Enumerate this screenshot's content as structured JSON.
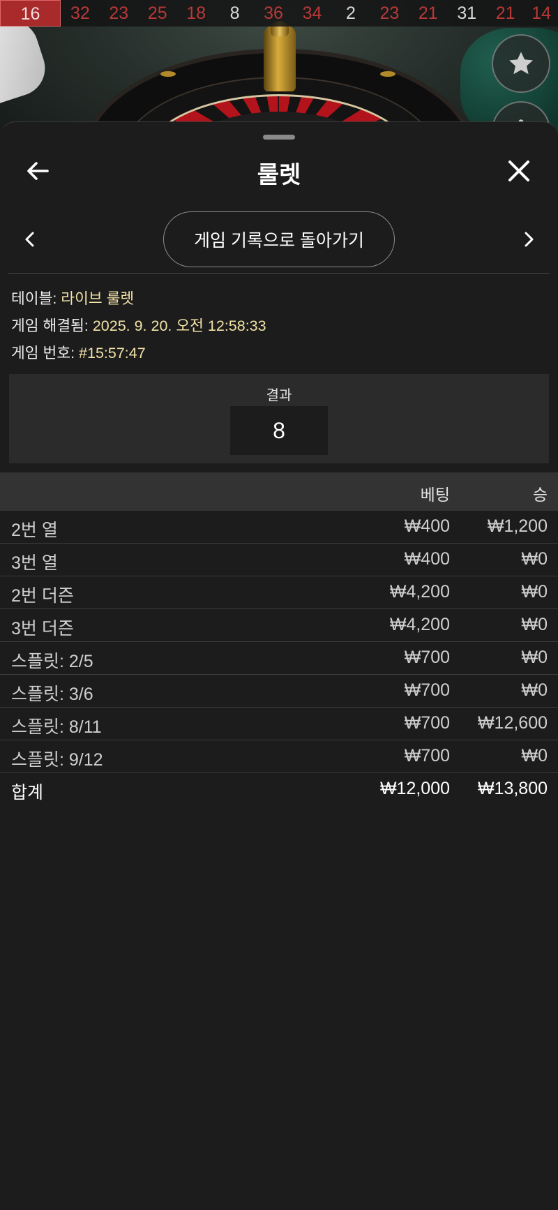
{
  "history": {
    "latest": "16",
    "items": [
      {
        "num": "32",
        "color": "red"
      },
      {
        "num": "23",
        "color": "red"
      },
      {
        "num": "25",
        "color": "red"
      },
      {
        "num": "18",
        "color": "red"
      },
      {
        "num": "8",
        "color": "black"
      },
      {
        "num": "36",
        "color": "red"
      },
      {
        "num": "34",
        "color": "red"
      },
      {
        "num": "2",
        "color": "black"
      },
      {
        "num": "23",
        "color": "red"
      },
      {
        "num": "21",
        "color": "red"
      },
      {
        "num": "31",
        "color": "black"
      },
      {
        "num": "21",
        "color": "red"
      },
      {
        "num": "14",
        "color": "red"
      }
    ]
  },
  "side_buttons": {
    "star_icon": "star-icon",
    "more_icon": "more-icon"
  },
  "sheet": {
    "title": "룰렛",
    "back_icon": "arrow-left-icon",
    "close_icon": "close-icon",
    "history_button": "게임 기록으로 돌아가기"
  },
  "meta": {
    "table_label": "테이블: ",
    "table_value": "라이브 룰렛",
    "resolved_label": "게임 해결됨: ",
    "resolved_value": "2025. 9. 20. 오전 12:58:33",
    "game_no_label": "게임 번호: ",
    "game_no_value": "#15:57:47"
  },
  "result": {
    "label": "결과",
    "number": "8"
  },
  "bets": {
    "head": {
      "bet": "베팅",
      "win": "승"
    },
    "rows": [
      {
        "name": "2번 열",
        "bet": "₩400",
        "win": "₩1,200"
      },
      {
        "name": "3번 열",
        "bet": "₩400",
        "win": "₩0"
      },
      {
        "name": "2번 더즌",
        "bet": "₩4,200",
        "win": "₩0"
      },
      {
        "name": "3번 더즌",
        "bet": "₩4,200",
        "win": "₩0"
      },
      {
        "name": "스플릿: 2/5",
        "bet": "₩700",
        "win": "₩0"
      },
      {
        "name": "스플릿: 3/6",
        "bet": "₩700",
        "win": "₩0"
      },
      {
        "name": "스플릿: 8/11",
        "bet": "₩700",
        "win": "₩12,600"
      },
      {
        "name": "스플릿: 9/12",
        "bet": "₩700",
        "win": "₩0"
      }
    ],
    "total": {
      "name": "합계",
      "bet": "₩12,000",
      "win": "₩13,800"
    }
  },
  "colors": {
    "accent_value": "#f2e2a6",
    "red_number": "#b93838",
    "latest_bg": "#a82a2a",
    "sheet_bg": "#1c1c1c"
  }
}
